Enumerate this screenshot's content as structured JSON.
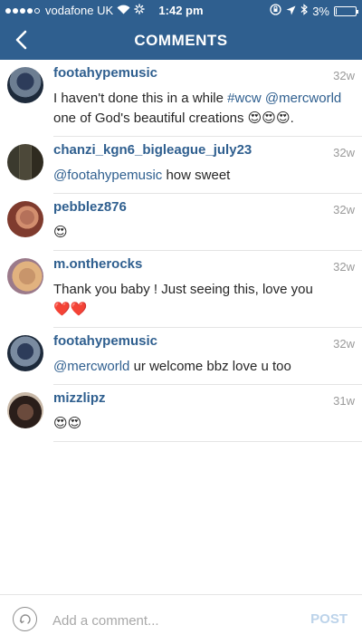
{
  "status_bar": {
    "carrier": "vodafone UK",
    "time": "1:42 pm",
    "battery": "3%",
    "battery_level": 0.03
  },
  "header": {
    "title": "COMMENTS",
    "back_icon": "chevron-left-icon"
  },
  "comments": [
    {
      "username": "footahypemusic",
      "time": "32w",
      "text_plain": "I haven't done this in a while ",
      "hashtag": "#wcw",
      "mention": "@mercworld",
      "text_tail": "one of God's beautiful creations",
      "emoji": "😍😍😍",
      "suffix": "."
    },
    {
      "username": "chanzi_kgn6_bigleague_july23",
      "time": "32w",
      "mention": "@footahypemusic",
      "text": " how sweet"
    },
    {
      "username": "pebblez876",
      "time": "32w",
      "emoji": "😍"
    },
    {
      "username": "m.ontherocks",
      "time": "32w",
      "text": "Thank you baby ! Just seeing this, love you",
      "emoji": "❤️❤️"
    },
    {
      "username": "footahypemusic",
      "time": "32w",
      "mention": "@mercworld",
      "text": " ur welcome bbz love u too"
    },
    {
      "username": "mizzlipz",
      "time": "31w",
      "emoji": "😍😍"
    }
  ],
  "composer": {
    "placeholder": "Add a comment...",
    "post_label": "POST"
  },
  "colors": {
    "brand": "#2f5f8f",
    "post_disabled": "#bcd3ea"
  }
}
